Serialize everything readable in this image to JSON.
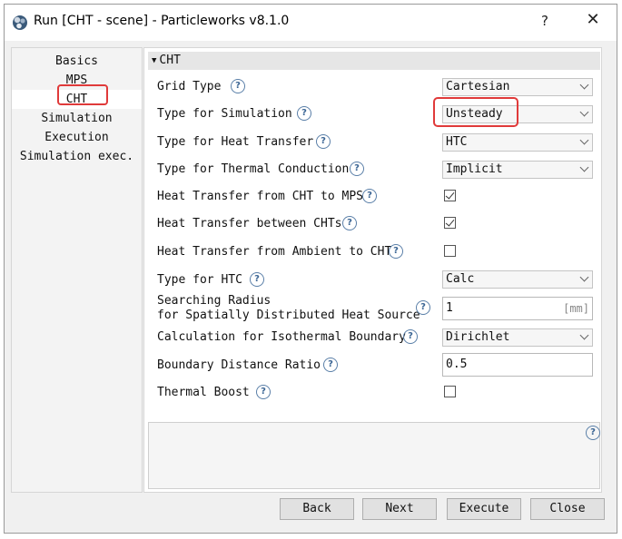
{
  "window": {
    "title": "Run [CHT - scene] - Particleworks v8.1.0",
    "help_label": "?",
    "close_label": "✕"
  },
  "nav": {
    "items": [
      {
        "label": "Basics",
        "selected": false
      },
      {
        "label": "MPS",
        "selected": false
      },
      {
        "label": "CHT",
        "selected": true
      },
      {
        "label": "Simulation",
        "selected": false
      },
      {
        "label": "Execution",
        "selected": false
      },
      {
        "label": "Simulation exec.",
        "selected": false
      }
    ]
  },
  "panel": {
    "section_title": "CHT",
    "help_glyph": "?",
    "rows": {
      "grid_type": {
        "label": "Grid Type",
        "value": "Cartesian"
      },
      "type_for_simulation": {
        "label": "Type for Simulation",
        "value": "Unsteady"
      },
      "type_for_heat_transfer": {
        "label": "Type for Heat Transfer",
        "value": "HTC"
      },
      "type_for_thermal_conduction": {
        "label": "Type for Thermal Conduction",
        "value": "Implicit"
      },
      "ht_cht_to_mps": {
        "label": "Heat Transfer from CHT to MPS",
        "checked": true
      },
      "ht_between_chts": {
        "label": "Heat Transfer between CHTs",
        "checked": true
      },
      "ht_ambient_to_cht": {
        "label": "Heat Transfer from Ambient to CHT",
        "checked": false
      },
      "type_for_htc": {
        "label": "Type for HTC",
        "value": "Calc"
      },
      "searching_radius": {
        "label_line1": "Searching Radius",
        "label_line2": "for Spatially Distributed Heat Source",
        "value": "1",
        "unit": "[mm]"
      },
      "isothermal_boundary": {
        "label": "Calculation for Isothermal Boundary",
        "value": "Dirichlet"
      },
      "boundary_distance_ratio": {
        "label": "Boundary Distance Ratio",
        "value": "0.5"
      },
      "thermal_boost": {
        "label": "Thermal Boost",
        "checked": false
      }
    }
  },
  "buttons": {
    "back": "Back",
    "next": "Next",
    "execute": "Execute",
    "close": "Close"
  },
  "colors": {
    "highlight": "#e03a3a",
    "help_icon": "#3b6594"
  }
}
